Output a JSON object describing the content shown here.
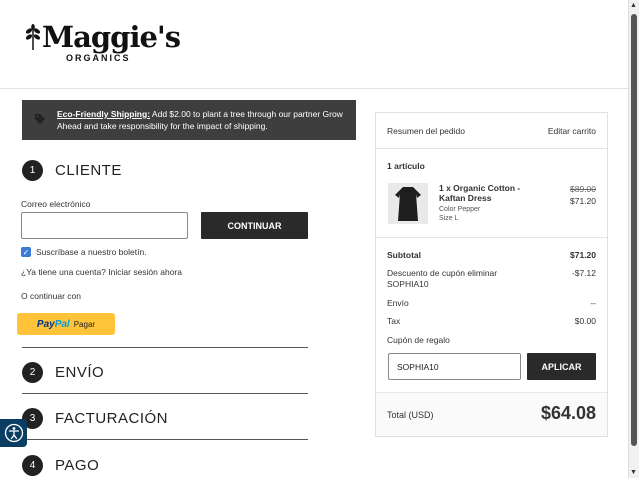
{
  "brand": {
    "name": "Maggie's",
    "sub": "ORGANICS"
  },
  "banner": {
    "link": "Eco-Friendly Shipping:",
    "text": " Add $2.00 to plant a tree through our partner Grow Ahead and take responsibility for the impact of shipping."
  },
  "steps": [
    {
      "num": "1",
      "title": "CLIENTE"
    },
    {
      "num": "2",
      "title": "ENVÍO"
    },
    {
      "num": "3",
      "title": "FACTURACIÓN"
    },
    {
      "num": "4",
      "title": "PAGO"
    }
  ],
  "customer": {
    "email_label": "Correo electrónico",
    "email_value": "",
    "continue_button": "CONTINUAR",
    "newsletter": "Suscríbase a nuestro boletín.",
    "have_account": "¿Ya tiene una cuenta?",
    "sign_in": "Iniciar sesión ahora",
    "or_continue": "O continuar con",
    "paypal_brand_1": "Pay",
    "paypal_brand_2": "Pal",
    "paypal_label": "Pagar"
  },
  "summary": {
    "title": "Resumen del pedido",
    "edit_cart": "Editar carrito",
    "item_count": "1 artículo",
    "item": {
      "name": "1 x Organic Cotton - Kaftan Dress",
      "color": "Color Pepper",
      "size": "Size L",
      "old_price": "$89.00",
      "price": "$71.20"
    },
    "subtotal_label": "Subtotal",
    "subtotal": "$71.20",
    "discount_label": "Descuento de cupón",
    "discount_remove": "eliminar",
    "discount_code": "SOPHIA10",
    "discount": "-$7.12",
    "shipping_label": "Envío",
    "shipping": "--",
    "tax_label": "Tax",
    "tax": "$0.00",
    "gift_label": "Cupón de regalo",
    "coupon_value": "SOPHIA10",
    "apply_button": "APLICAR",
    "total_label": "Total (USD)",
    "total": "$64.08"
  },
  "colors": {
    "dark": "#2a2a2a",
    "paypal_yellow": "#ffc439",
    "checkbox_blue": "#3a7bd5",
    "a11y": "#0a3d62"
  }
}
